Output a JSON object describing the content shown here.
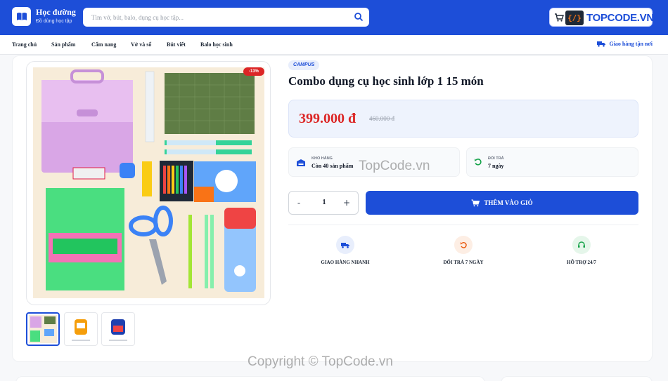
{
  "header": {
    "brand_title": "Học đường",
    "brand_sub": "Đồ dùng học tập",
    "search_placeholder": "Tìm vở, bút, balo, dụng cụ học tập...",
    "logo_text": "TOPCODE.VN",
    "logo_mark": "{/}"
  },
  "nav": {
    "items": [
      "Trang chủ",
      "Sản phẩm",
      "Cẩm nang",
      "Vở và sổ",
      "Bút viết",
      "Balo học sinh"
    ],
    "shipping": "Giao hàng tận nơi"
  },
  "product": {
    "discount_badge": "-13%",
    "brand": "CAMPUS",
    "title": "Combo dụng cụ học sinh lớp 1 15 món",
    "price": "399.000 đ",
    "old_price": "460.000 đ",
    "stock_label": "KHO HÀNG",
    "stock_value": "Còn 40 sản phẩm",
    "return_label": "ĐỔI TRẢ",
    "return_value": "7 ngày",
    "quantity": "1",
    "qty_minus": "-",
    "qty_plus": "+",
    "add_to_cart": "THÊM VÀO GIỎ"
  },
  "features": [
    {
      "label": "GIAO HÀNG NHANH",
      "icon": "truck-icon",
      "color": "#1d4ed8",
      "bg": "#e8eefc"
    },
    {
      "label": "ĐỔI TRẢ 7 NGÀY",
      "icon": "return-icon",
      "color": "#ea580c",
      "bg": "#fdeee4"
    },
    {
      "label": "HỖ TRỢ 24/7",
      "icon": "headset-icon",
      "color": "#16a34a",
      "bg": "#e5f6ea"
    }
  ],
  "watermarks": {
    "center": "TopCode.vn",
    "bottom": "Copyright © TopCode.vn"
  },
  "colors": {
    "primary": "#1d4ed8",
    "price": "#dc2626"
  }
}
